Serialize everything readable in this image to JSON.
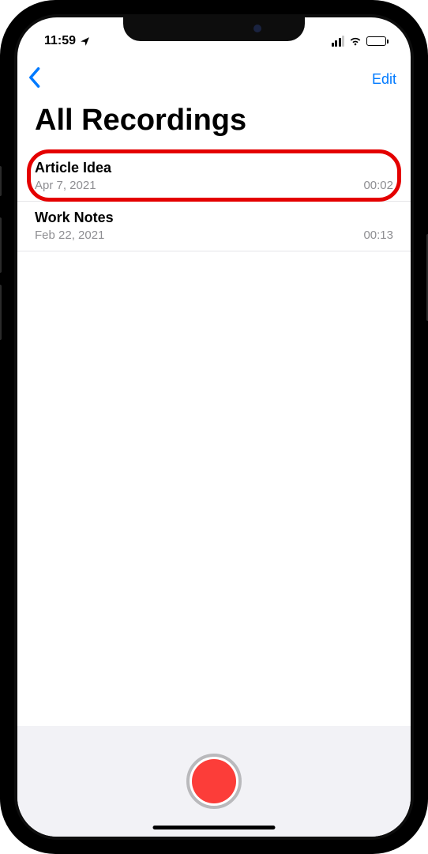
{
  "status": {
    "time": "11:59",
    "location_glyph": "➤"
  },
  "nav": {
    "edit_label": "Edit"
  },
  "page_title": "All Recordings",
  "recordings": [
    {
      "title": "Article Idea",
      "date": "Apr 7, 2021",
      "duration": "00:02",
      "highlighted": true
    },
    {
      "title": "Work Notes",
      "date": "Feb 22, 2021",
      "duration": "00:13",
      "highlighted": false
    }
  ]
}
